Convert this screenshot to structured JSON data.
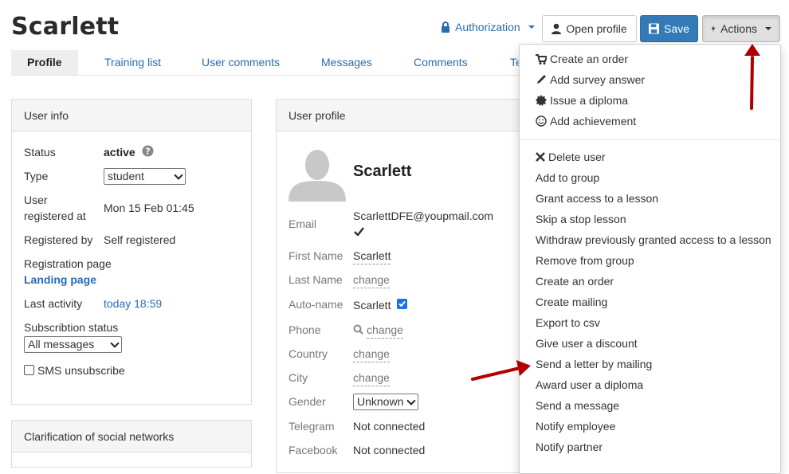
{
  "header": {
    "title": "Scarlett",
    "authorization_label": "Authorization",
    "open_profile_label": "Open profile",
    "save_label": "Save",
    "actions_label": "Actions"
  },
  "tabs": [
    "Profile",
    "Training list",
    "User comments",
    "Messages",
    "Comments",
    "Te"
  ],
  "user_info": {
    "heading": "User info",
    "status_label": "Status",
    "status_value": "active",
    "type_label": "Type",
    "type_value": "student",
    "registered_label_1": "User",
    "registered_label_2": "registered at",
    "registered_value": "Mon 15 Feb 01:45",
    "registered_by_label": "Registered by",
    "registered_by_value": "Self registered",
    "registration_page_label": "Registration page",
    "registration_page_value": "Landing page",
    "last_activity_label": "Last activity",
    "last_activity_value": "today 18:59",
    "subscription_label": "Subscribtion status",
    "subscription_value": "All messages",
    "sms_label": "SMS unsubscribe"
  },
  "social": {
    "heading": "Clarification of social networks"
  },
  "user_profile": {
    "heading": "User profile",
    "name": "Scarlett",
    "email_label": "Email",
    "email_value": "ScarlettDFE@youpmail.com",
    "first_name_label": "First Name",
    "first_name_value": "Scarlett",
    "last_name_label": "Last Name",
    "change": "change",
    "auto_name_label": "Auto-name",
    "auto_name_value": "Scarlett",
    "phone_label": "Phone",
    "country_label": "Country",
    "city_label": "City",
    "gender_label": "Gender",
    "gender_value": "Unknown",
    "telegram_label": "Telegram",
    "telegram_value": "Not connected",
    "facebook_label": "Facebook",
    "facebook_value": "Not connected"
  },
  "actions_menu": {
    "group1": [
      "Create an order",
      "Add survey answer",
      "Issue a diploma",
      "Add achievement"
    ],
    "group2": [
      "Delete user",
      "Add to group",
      "Grant access to a lesson",
      "Skip a stop lesson",
      "Withdraw previously granted access to a lesson",
      "Remove from group",
      "Create an order",
      "Create mailing",
      "Export to csv",
      "Give user a discount",
      "Send a letter by mailing",
      "Award user a diploma",
      "Send a message",
      "Notify employee",
      "Notify partner"
    ]
  },
  "colors": {
    "accent": "#2a6cb0",
    "save": "#337ab7",
    "arrow": "#b00000"
  }
}
